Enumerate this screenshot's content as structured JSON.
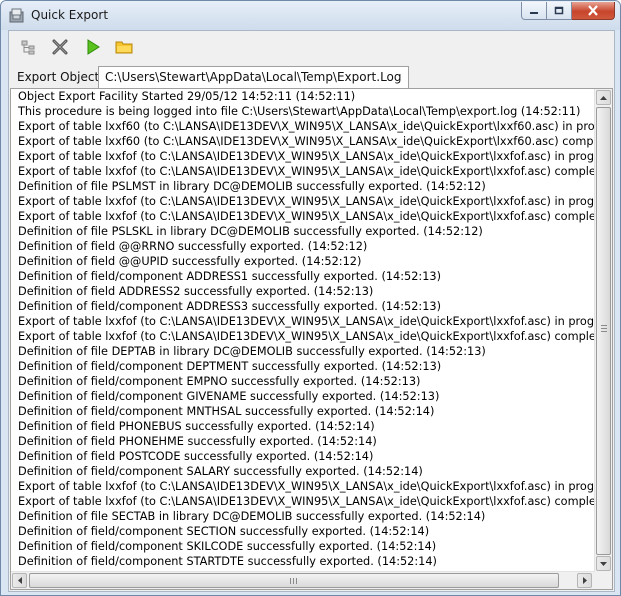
{
  "window": {
    "title": "Quick Export",
    "buttons": {
      "minimize": "minimize",
      "maximize": "maximize",
      "close": "close"
    }
  },
  "toolbar": {
    "icons": [
      "tree-icon",
      "delete-icon",
      "run-icon",
      "folder-icon"
    ]
  },
  "tabs": [
    {
      "label": "Export Objects",
      "active": false
    },
    {
      "label": "C:\\Users\\Stewart\\AppData\\Local\\Temp\\Export.Log",
      "active": true
    }
  ],
  "log": {
    "lines": [
      "Object Export Facility Started 29/05/12 14:52:11 (14:52:11)",
      "This procedure is being logged into file C:\\Users\\Stewart\\AppData\\Local\\Temp\\export.log (14:52:11)",
      "Export of table lxxf60 (to C:\\LANSA\\IDE13DEV\\X_WIN95\\X_LANSA\\x_ide\\QuickExport\\lxxf60.asc) in progress. Pl",
      "Export of table lxxf60 (to C:\\LANSA\\IDE13DEV\\X_WIN95\\X_LANSA\\x_ide\\QuickExport\\lxxf60.asc) completed nc",
      "Export of table lxxfof (to C:\\LANSA\\IDE13DEV\\X_WIN95\\X_LANSA\\x_ide\\QuickExport\\lxxfof.asc) in progress. Pl",
      "Export of table lxxfof (to C:\\LANSA\\IDE13DEV\\X_WIN95\\X_LANSA\\x_ide\\QuickExport\\lxxfof.asc) completed nc",
      "Definition of file PSLMST in library DC@DEMOLIB successfully exported. (14:52:12)",
      "Export of table lxxfof (to C:\\LANSA\\IDE13DEV\\X_WIN95\\X_LANSA\\x_ide\\QuickExport\\lxxfof.asc) in progress. Pl",
      "Export of table lxxfof (to C:\\LANSA\\IDE13DEV\\X_WIN95\\X_LANSA\\x_ide\\QuickExport\\lxxfof.asc) completed nc",
      "Definition of file PSLSKL in library DC@DEMOLIB successfully exported. (14:52:12)",
      "Definition of field @@RRNO successfully exported. (14:52:12)",
      "Definition of field @@UPID successfully exported. (14:52:12)",
      "Definition of field/component ADDRESS1 successfully exported. (14:52:13)",
      "Definition of field ADDRESS2 successfully exported. (14:52:13)",
      "Definition of field/component ADDRESS3 successfully exported. (14:52:13)",
      "Export of table lxxfof (to C:\\LANSA\\IDE13DEV\\X_WIN95\\X_LANSA\\x_ide\\QuickExport\\lxxfof.asc) in progress. Pl",
      "Export of table lxxfof (to C:\\LANSA\\IDE13DEV\\X_WIN95\\X_LANSA\\x_ide\\QuickExport\\lxxfof.asc) completed nc",
      "Definition of file DEPTAB in library DC@DEMOLIB successfully exported. (14:52:13)",
      "Definition of field/component DEPTMENT successfully exported. (14:52:13)",
      "Definition of field/component EMPNO successfully exported. (14:52:13)",
      "Definition of field/component GIVENAME successfully exported. (14:52:13)",
      "Definition of field/component MNTHSAL successfully exported. (14:52:14)",
      "Definition of field PHONEBUS successfully exported. (14:52:14)",
      "Definition of field PHONEHME successfully exported. (14:52:14)",
      "Definition of field POSTCODE successfully exported. (14:52:14)",
      "Definition of field/component SALARY successfully exported. (14:52:14)",
      "Export of table lxxfof (to C:\\LANSA\\IDE13DEV\\X_WIN95\\X_LANSA\\x_ide\\QuickExport\\lxxfof.asc) in progress. Pl",
      "Export of table lxxfof (to C:\\LANSA\\IDE13DEV\\X_WIN95\\X_LANSA\\x_ide\\QuickExport\\lxxfof.asc) completed nc",
      "Definition of file SECTAB in library DC@DEMOLIB successfully exported. (14:52:14)",
      "Definition of field/component SECTION successfully exported. (14:52:14)",
      "Definition of field/component SKILCODE successfully exported. (14:52:14)",
      "Definition of field/component STARTDTE successfully exported. (14:52:14)"
    ]
  },
  "colors": {
    "title_bg": "#d9e5f2",
    "close_button": "#c7452c"
  }
}
